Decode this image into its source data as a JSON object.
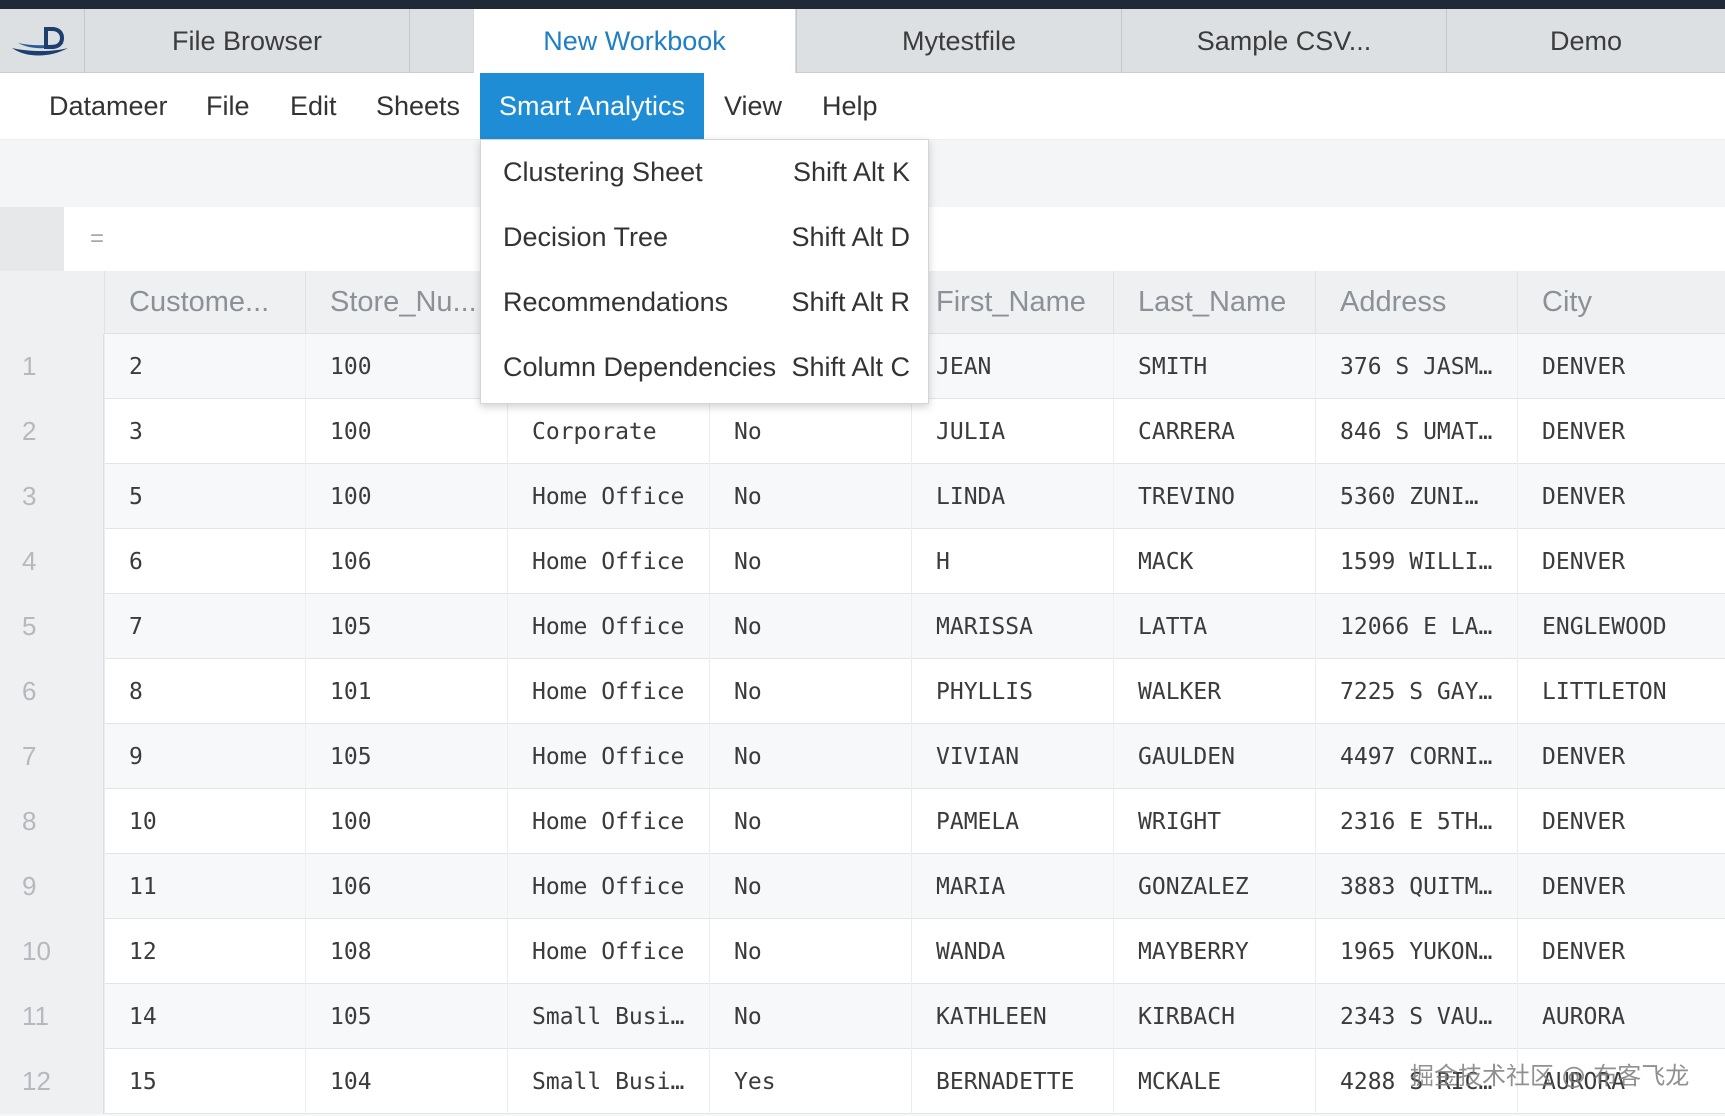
{
  "tabs": [
    {
      "label": "File Browser",
      "active": false
    },
    {
      "label": "New Workbook",
      "active": true
    },
    {
      "label": "Mytestfile",
      "active": false
    },
    {
      "label": "Sample CSV...",
      "active": false
    },
    {
      "label": "Demo",
      "active": false
    }
  ],
  "menu": [
    {
      "label": "Datameer"
    },
    {
      "label": "File"
    },
    {
      "label": "Edit"
    },
    {
      "label": "Sheets"
    },
    {
      "label": "Smart Analytics",
      "active": true
    },
    {
      "label": "View"
    },
    {
      "label": "Help"
    }
  ],
  "formula": {
    "symbol": "="
  },
  "dropdown": [
    {
      "label": "Clustering Sheet",
      "shortcut": "Shift Alt K"
    },
    {
      "label": "Decision Tree",
      "shortcut": "Shift Alt D"
    },
    {
      "label": "Recommendations",
      "shortcut": "Shift Alt R"
    },
    {
      "label": "Column Dependencies",
      "shortcut": "Shift Alt C"
    }
  ],
  "columns": [
    "Custome...",
    "Store_Nu...",
    "",
    "",
    "First_Name",
    "Last_Name",
    "Address",
    "City"
  ],
  "rows": [
    {
      "n": "1",
      "cells": [
        "2",
        "100",
        "",
        "",
        "JEAN",
        "SMITH",
        "376 S JASM…",
        "DENVER"
      ]
    },
    {
      "n": "2",
      "cells": [
        "3",
        "100",
        "Corporate",
        "No",
        "JULIA",
        "CARRERA",
        "846 S UMAT…",
        "DENVER"
      ]
    },
    {
      "n": "3",
      "cells": [
        "5",
        "100",
        "Home Office",
        "No",
        "LINDA",
        "TREVINO",
        "5360 ZUNI…",
        "DENVER"
      ]
    },
    {
      "n": "4",
      "cells": [
        "6",
        "106",
        "Home Office",
        "No",
        "H",
        "MACK",
        "1599 WILLI…",
        "DENVER"
      ]
    },
    {
      "n": "5",
      "cells": [
        "7",
        "105",
        "Home Office",
        "No",
        "MARISSA",
        "LATTA",
        "12066 E LA…",
        "ENGLEWOOD"
      ]
    },
    {
      "n": "6",
      "cells": [
        "8",
        "101",
        "Home Office",
        "No",
        "PHYLLIS",
        "WALKER",
        "7225 S GAY…",
        "LITTLETON"
      ]
    },
    {
      "n": "7",
      "cells": [
        "9",
        "105",
        "Home Office",
        "No",
        "VIVIAN",
        "GAULDEN",
        "4497 CORNI…",
        "DENVER"
      ]
    },
    {
      "n": "8",
      "cells": [
        "10",
        "100",
        "Home Office",
        "No",
        "PAMELA",
        "WRIGHT",
        "2316 E 5TH…",
        "DENVER"
      ]
    },
    {
      "n": "9",
      "cells": [
        "11",
        "106",
        "Home Office",
        "No",
        "MARIA",
        "GONZALEZ",
        "3883 QUITM…",
        "DENVER"
      ]
    },
    {
      "n": "10",
      "cells": [
        "12",
        "108",
        "Home Office",
        "No",
        "WANDA",
        "MAYBERRY",
        "1965 YUKON…",
        "DENVER"
      ]
    },
    {
      "n": "11",
      "cells": [
        "14",
        "105",
        "Small Busi…",
        "No",
        "KATHLEEN",
        "KIRBACH",
        "2343 S VAU…",
        "AURORA"
      ]
    },
    {
      "n": "12",
      "cells": [
        "15",
        "104",
        "Small Busi…",
        "Yes",
        "BERNADETTE",
        "MCKALE",
        "4288 S RIC…",
        "AURORA"
      ]
    }
  ],
  "watermark": "掘金技术社区 @ 布客飞龙",
  "colors": {
    "accent": "#1f8dd6",
    "active_tab_text": "#1f7fc4",
    "topbar": "#1f2a36"
  }
}
